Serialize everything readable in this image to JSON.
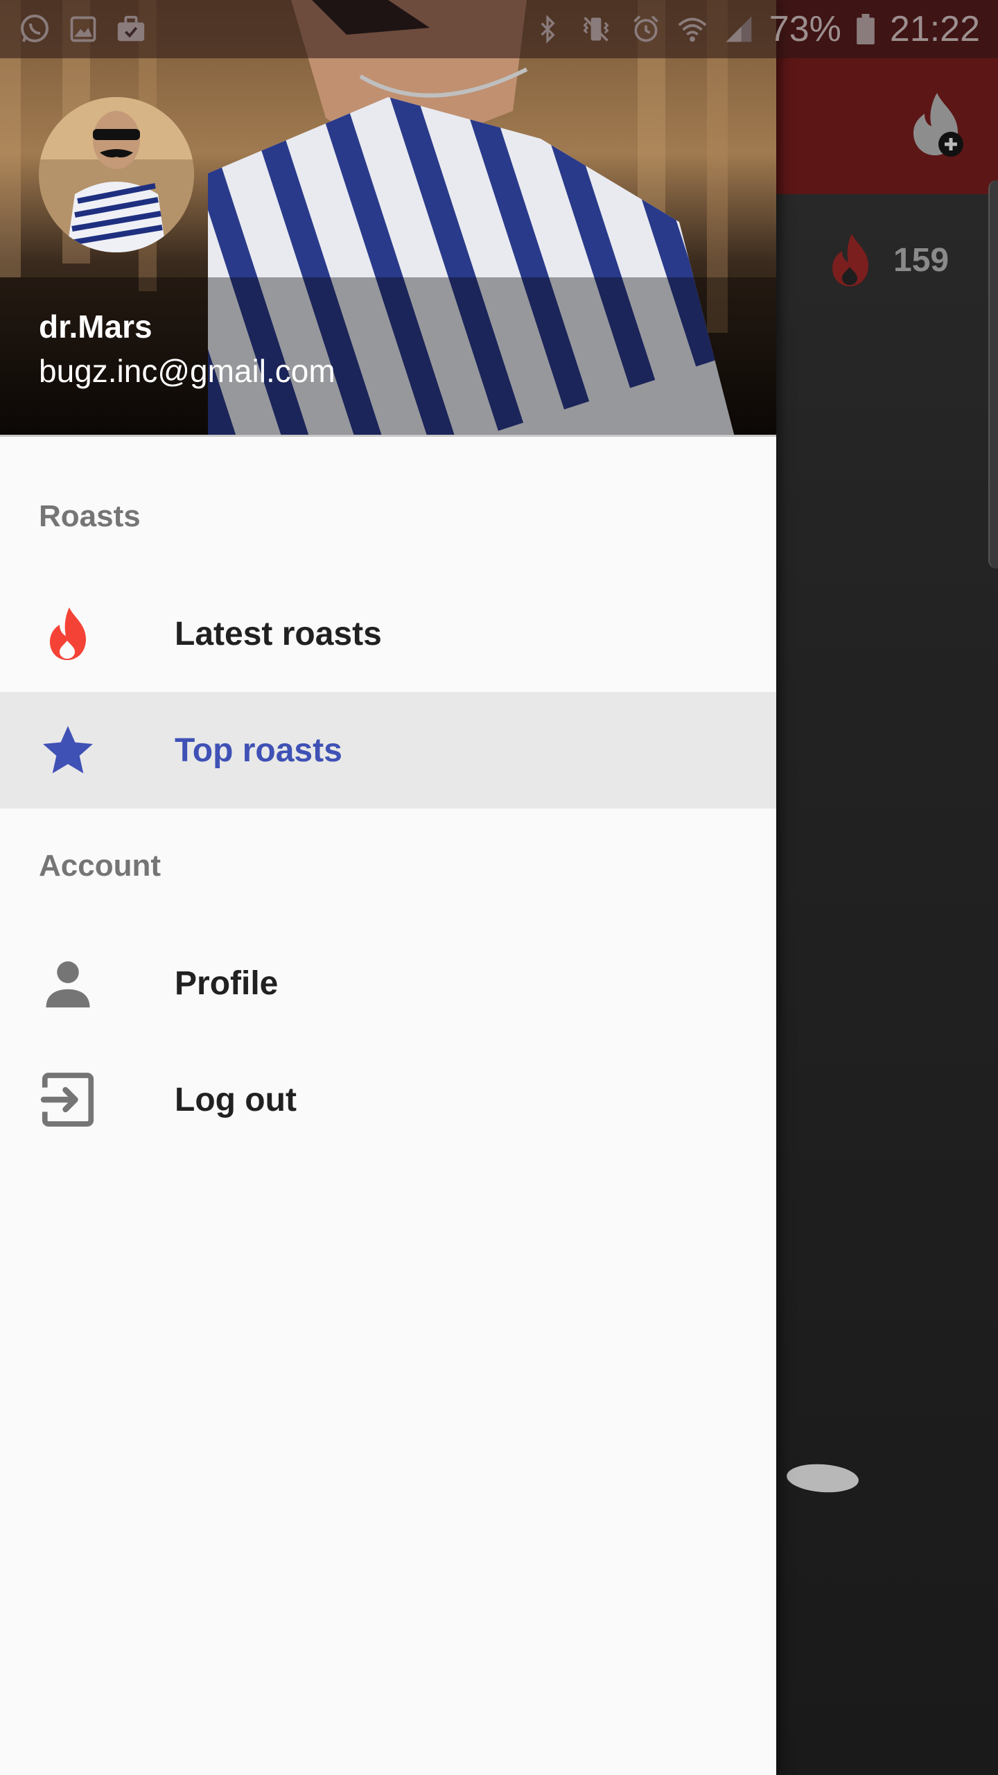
{
  "status_bar": {
    "battery_percent": "73%",
    "time": "21:22",
    "left_icons": [
      "whatsapp-icon",
      "gallery-icon",
      "briefcase-icon"
    ],
    "right_icons": [
      "bluetooth-icon",
      "vibrate-icon",
      "alarm-icon",
      "wifi-icon",
      "signal-icon",
      "battery-icon"
    ]
  },
  "drawer": {
    "user": {
      "name": "dr.Mars",
      "email": "bugz.inc@gmail.com"
    },
    "sections": [
      {
        "title": "Roasts",
        "items": [
          {
            "label": "Latest roasts",
            "icon": "flame-icon",
            "active": false
          },
          {
            "label": "Top roasts",
            "icon": "star-icon",
            "active": true
          }
        ]
      },
      {
        "title": "Account",
        "items": [
          {
            "label": "Profile",
            "icon": "person-icon",
            "active": false
          },
          {
            "label": "Log out",
            "icon": "logout-icon",
            "active": false
          }
        ]
      }
    ]
  },
  "background_app": {
    "score": "159"
  },
  "colors": {
    "accent": "#3f51b5",
    "flame": "#f44336",
    "toolbar": "#c62828"
  }
}
